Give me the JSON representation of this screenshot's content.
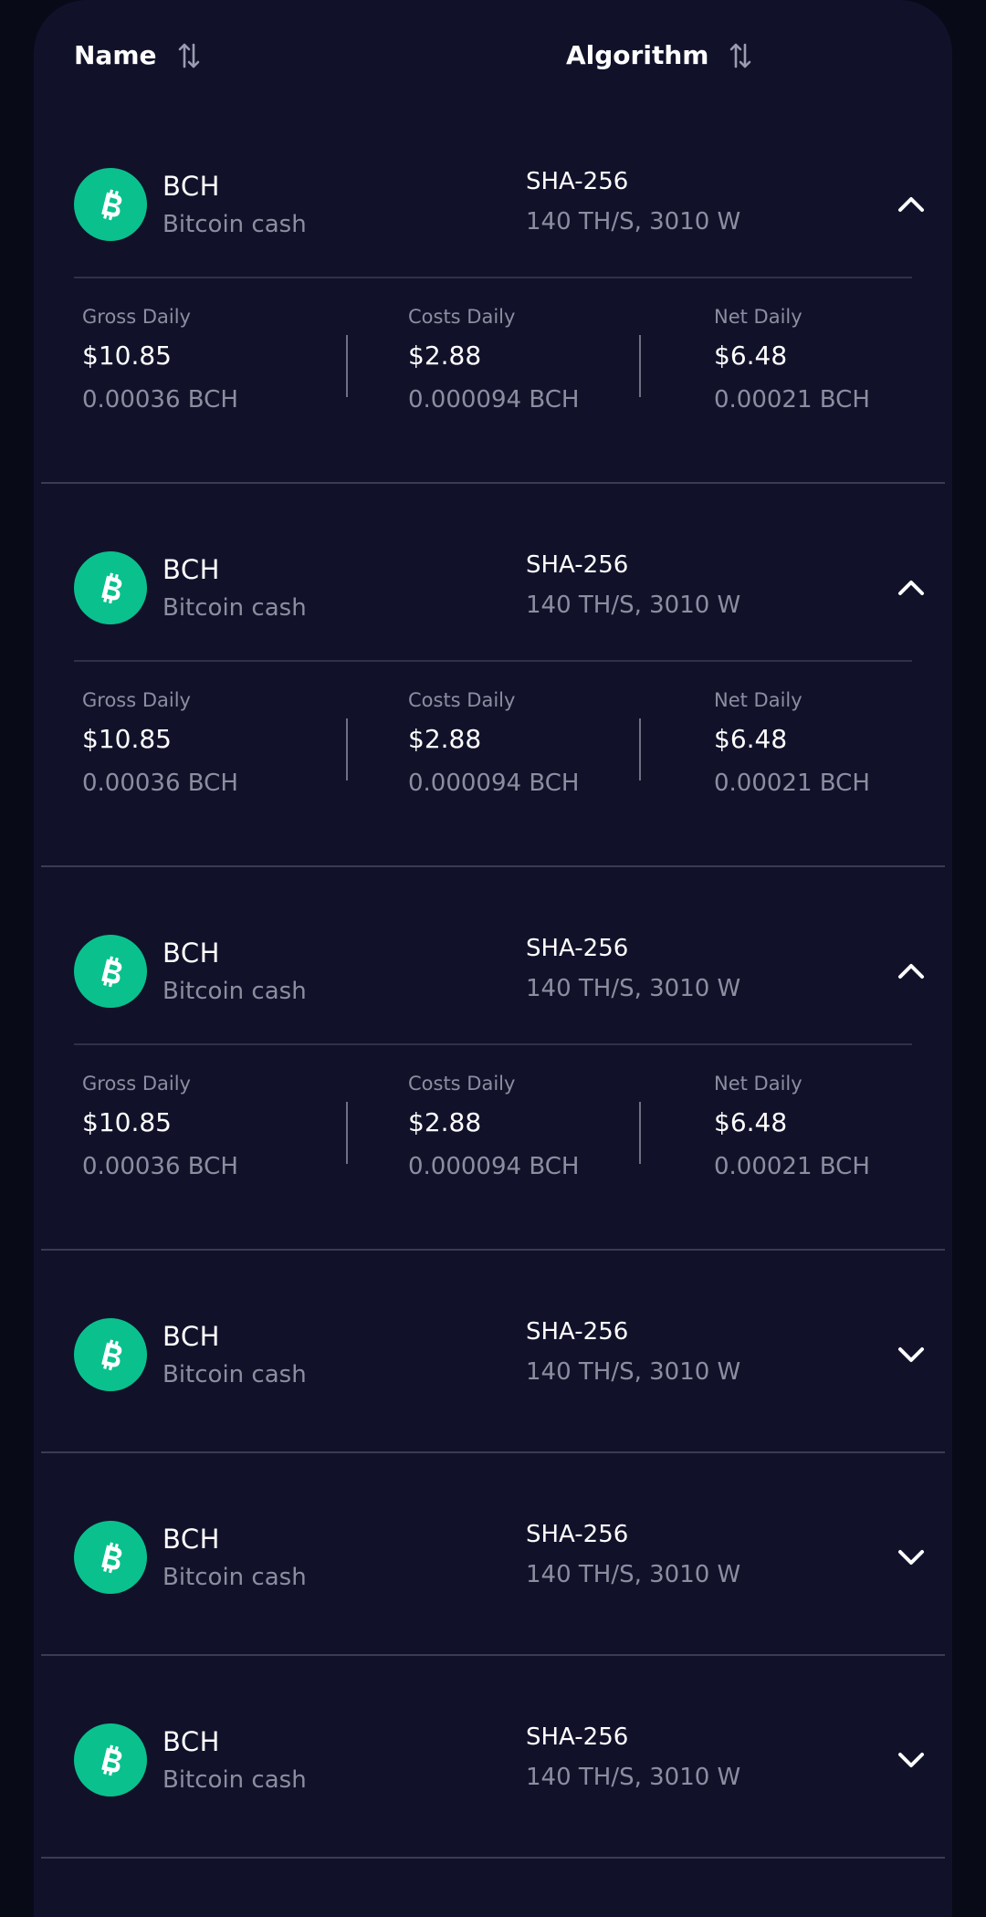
{
  "header": {
    "name_label": "Name",
    "algorithm_label": "Algorithm",
    "sort_icon": "sort-up-down-icon"
  },
  "colors": {
    "background": "#080a18",
    "panel": "#11122a",
    "coin_green": "#0ac18e",
    "muted_text": "#8c8ea0",
    "separator": "#3a3c52"
  },
  "rows": [
    {
      "symbol": "BCH",
      "name": "Bitcoin cash",
      "algorithm": "SHA-256",
      "spec": "140 TH/S, 3010 W",
      "expanded": true,
      "chevron_icon": "chevron-up-icon",
      "gross_label": "Gross Daily",
      "gross_usd": "$10.85",
      "gross_coin": "0.00036 BCH",
      "costs_label": "Costs Daily",
      "costs_usd": "$2.88",
      "costs_coin": "0.000094 BCH",
      "net_label": "Net Daily",
      "net_usd": "$6.48",
      "net_coin": "0.00021 BCH"
    },
    {
      "symbol": "BCH",
      "name": "Bitcoin cash",
      "algorithm": "SHA-256",
      "spec": "140 TH/S, 3010 W",
      "expanded": true,
      "chevron_icon": "chevron-up-icon",
      "gross_label": "Gross Daily",
      "gross_usd": "$10.85",
      "gross_coin": "0.00036 BCH",
      "costs_label": "Costs Daily",
      "costs_usd": "$2.88",
      "costs_coin": "0.000094 BCH",
      "net_label": "Net Daily",
      "net_usd": "$6.48",
      "net_coin": "0.00021 BCH"
    },
    {
      "symbol": "BCH",
      "name": "Bitcoin cash",
      "algorithm": "SHA-256",
      "spec": "140 TH/S, 3010 W",
      "expanded": true,
      "chevron_icon": "chevron-up-icon",
      "gross_label": "Gross Daily",
      "gross_usd": "$10.85",
      "gross_coin": "0.00036 BCH",
      "costs_label": "Costs Daily",
      "costs_usd": "$2.88",
      "costs_coin": "0.000094 BCH",
      "net_label": "Net Daily",
      "net_usd": "$6.48",
      "net_coin": "0.00021 BCH"
    },
    {
      "symbol": "BCH",
      "name": "Bitcoin cash",
      "algorithm": "SHA-256",
      "spec": "140 TH/S, 3010 W",
      "expanded": false,
      "chevron_icon": "chevron-down-icon"
    },
    {
      "symbol": "BCH",
      "name": "Bitcoin cash",
      "algorithm": "SHA-256",
      "spec": "140 TH/S, 3010 W",
      "expanded": false,
      "chevron_icon": "chevron-down-icon"
    },
    {
      "symbol": "BCH",
      "name": "Bitcoin cash",
      "algorithm": "SHA-256",
      "spec": "140 TH/S, 3010 W",
      "expanded": false,
      "chevron_icon": "chevron-down-icon"
    }
  ]
}
